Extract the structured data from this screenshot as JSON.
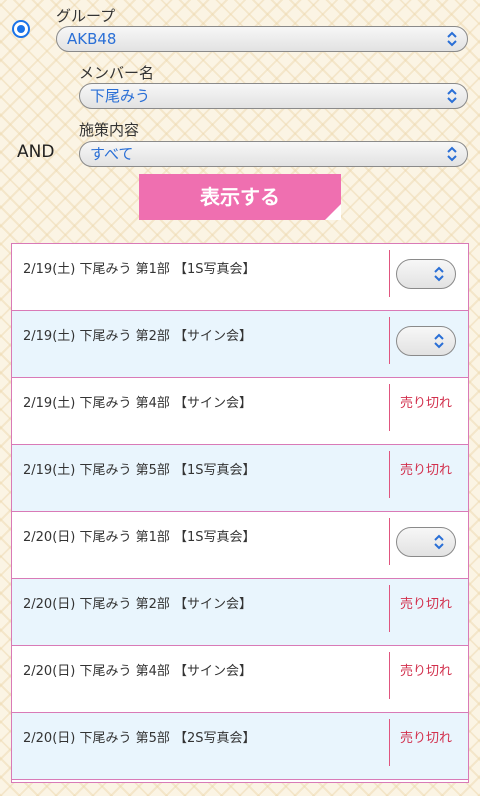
{
  "filters": {
    "group": {
      "label": "グループ",
      "value": "AKB48"
    },
    "member": {
      "label": "メンバー名",
      "value": "下尾みう"
    },
    "event": {
      "label": "施策内容",
      "value": "すべて"
    },
    "and_label": "AND",
    "submit_label": "表示する"
  },
  "slots": [
    {
      "text": "2/19(土) 下尾みう 第1部 【1S写真会】",
      "status": "select"
    },
    {
      "text": "2/19(土) 下尾みう 第2部 【サイン会】",
      "status": "select"
    },
    {
      "text": "2/19(土) 下尾みう 第4部 【サイン会】",
      "status": "売り切れ"
    },
    {
      "text": "2/19(土) 下尾みう 第5部 【1S写真会】",
      "status": "売り切れ"
    },
    {
      "text": "2/20(日) 下尾みう 第1部 【1S写真会】",
      "status": "select"
    },
    {
      "text": "2/20(日) 下尾みう 第2部 【サイン会】",
      "status": "売り切れ"
    },
    {
      "text": "2/20(日) 下尾みう 第4部 【サイン会】",
      "status": "売り切れ"
    },
    {
      "text": "2/20(日) 下尾みう 第5部 【2S写真会】",
      "status": "売り切れ"
    }
  ]
}
